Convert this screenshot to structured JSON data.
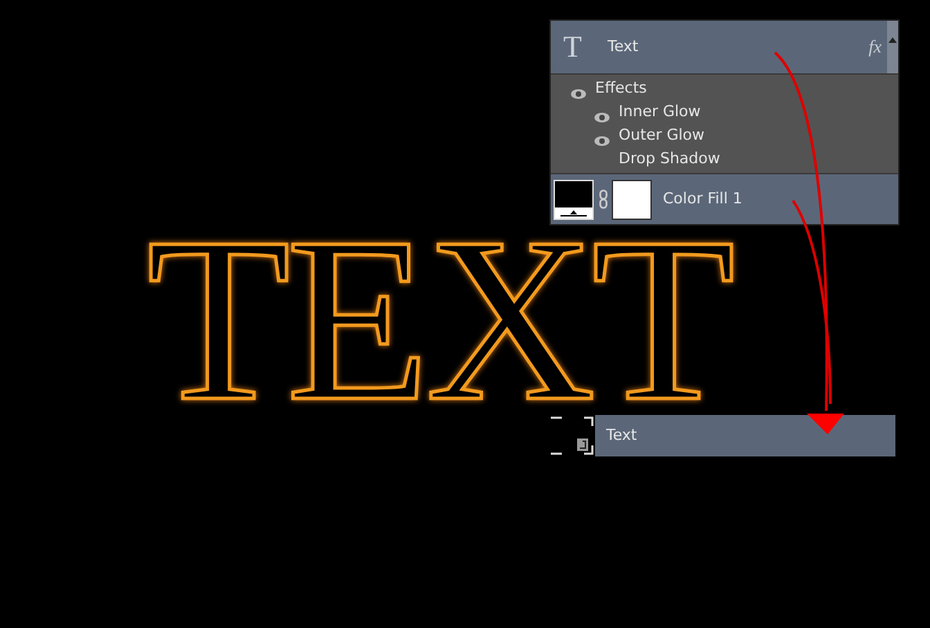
{
  "canvas_text": "TEXT",
  "layers_panel": {
    "text_layer": {
      "type_icon": "T",
      "name": "Text",
      "fx": "fx"
    },
    "effects": {
      "label": "Effects",
      "visible": true,
      "items": [
        {
          "name": "Inner Glow",
          "visible": true
        },
        {
          "name": "Outer Glow",
          "visible": true
        },
        {
          "name": "Drop Shadow",
          "visible": false
        }
      ]
    },
    "fill_layer": {
      "name": "Color Fill 1"
    }
  },
  "dragged_layer": {
    "name": "Text"
  }
}
